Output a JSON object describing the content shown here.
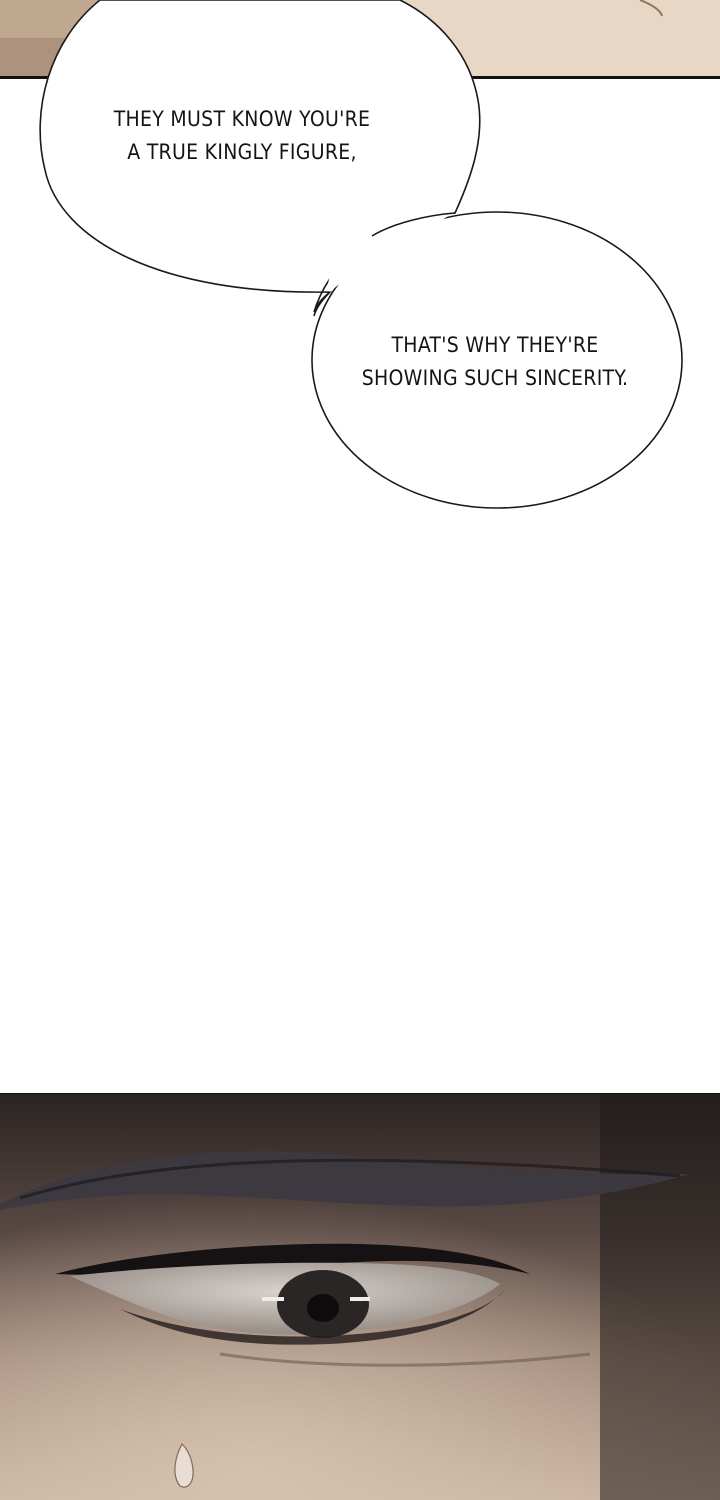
{
  "speech_bubbles": [
    {
      "lines": [
        "THEY MUST KNOW YOU'RE",
        "A TRUE KINGLY FIGURE,"
      ]
    },
    {
      "lines": [
        "THAT'S WHY THEY'RE",
        "SHOWING SUCH SINCERITY."
      ]
    }
  ],
  "colors": {
    "page_background": "#ffffff",
    "panel_border": "#111111",
    "top_panel_skin": "#d9c4ae",
    "bottom_panel_shadow": "#2a2422",
    "bottom_panel_skin": "#b69c8a"
  }
}
